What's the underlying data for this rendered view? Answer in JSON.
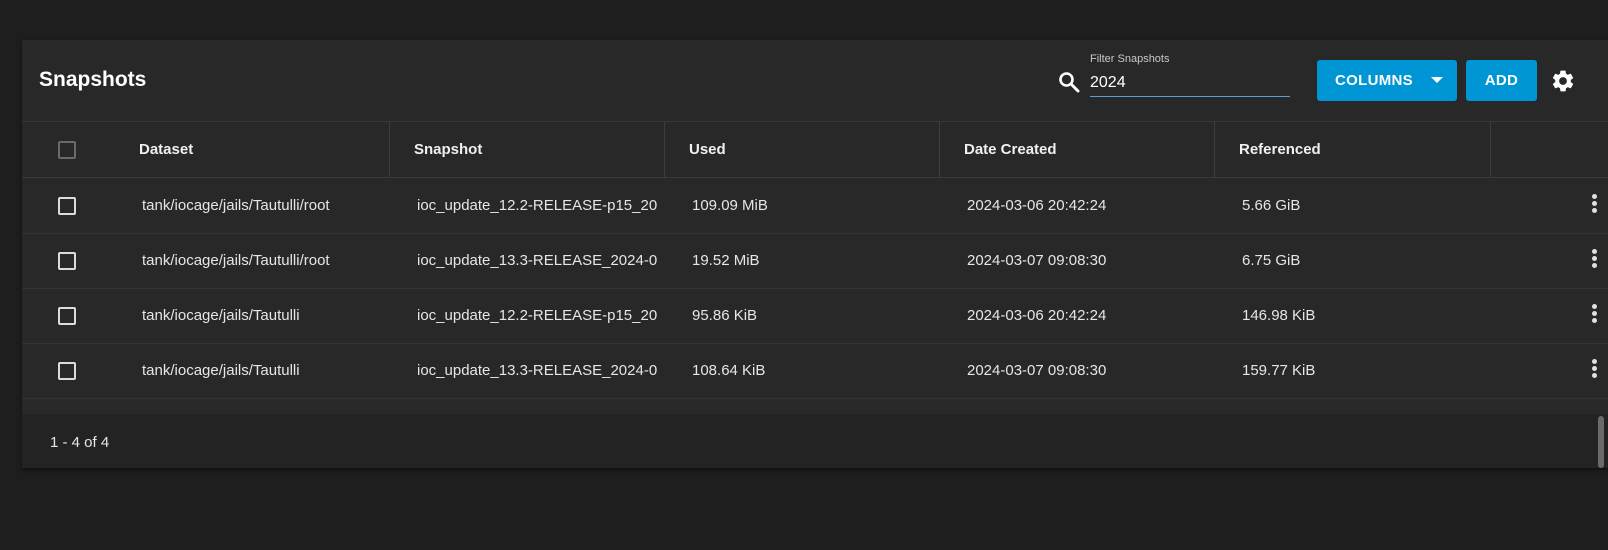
{
  "title": "Snapshots",
  "filter": {
    "label": "Filter Snapshots",
    "value": "2024"
  },
  "buttons": {
    "columns": "COLUMNS",
    "add": "ADD"
  },
  "icons": {
    "search": "search-icon",
    "columns_caret": "caret-down-icon",
    "settings": "gear-icon",
    "row_menu": "more-vert-icon"
  },
  "colors": {
    "accent": "#0095d5",
    "background": "#1e1e1e",
    "card": "#282828"
  },
  "columns": [
    "Dataset",
    "Snapshot",
    "Used",
    "Date Created",
    "Referenced"
  ],
  "rows": [
    {
      "dataset": "tank/iocage/jails/Tautulli/root",
      "snapshot": "ioc_update_12.2-RELEASE-p15_20",
      "used": "109.09 MiB",
      "date": "2024-03-06 20:42:24",
      "referenced": "5.66 GiB"
    },
    {
      "dataset": "tank/iocage/jails/Tautulli/root",
      "snapshot": "ioc_update_13.3-RELEASE_2024-0",
      "used": "19.52 MiB",
      "date": "2024-03-07 09:08:30",
      "referenced": "6.75 GiB"
    },
    {
      "dataset": "tank/iocage/jails/Tautulli",
      "snapshot": "ioc_update_12.2-RELEASE-p15_20",
      "used": "95.86 KiB",
      "date": "2024-03-06 20:42:24",
      "referenced": "146.98 KiB"
    },
    {
      "dataset": "tank/iocage/jails/Tautulli",
      "snapshot": "ioc_update_13.3-RELEASE_2024-0",
      "used": "108.64 KiB",
      "date": "2024-03-07 09:08:30",
      "referenced": "159.77 KiB"
    }
  ],
  "pagination": {
    "range": "1 - 4 of 4"
  }
}
